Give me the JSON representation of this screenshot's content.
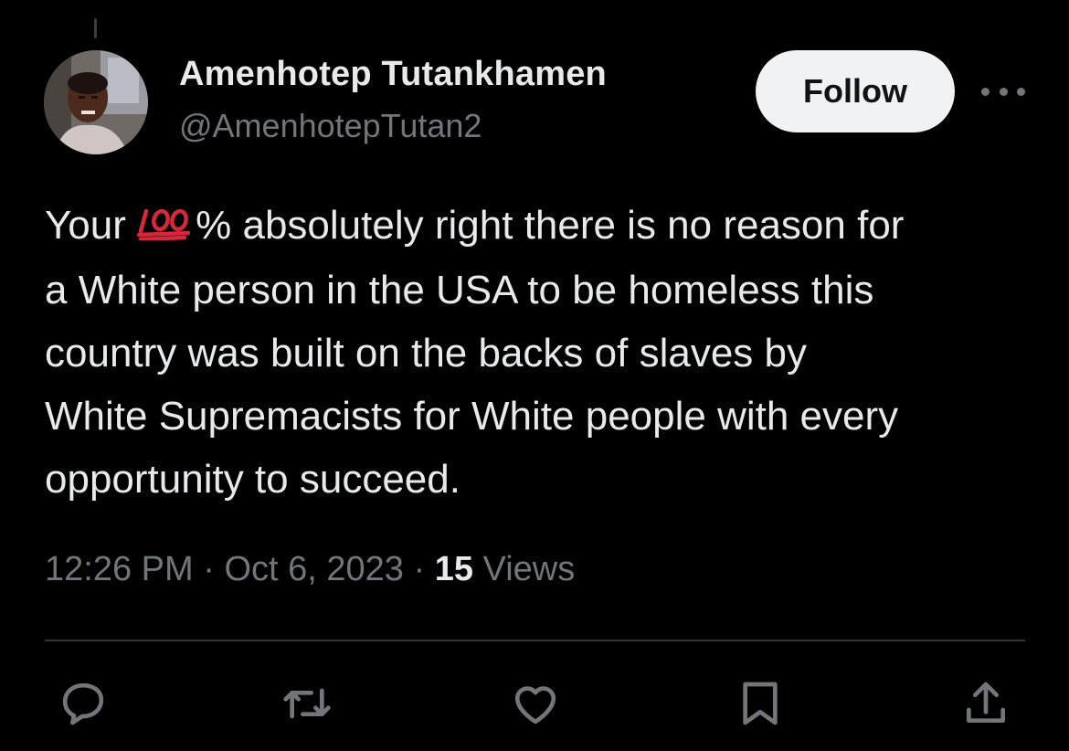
{
  "author": {
    "display_name": "Amenhotep Tutankhamen",
    "handle": "@AmenhotepTutan2",
    "avatar": "avatar-photo"
  },
  "follow_button": {
    "label": "Follow"
  },
  "more_menu": {
    "icon": "more-horizontal-icon"
  },
  "tweet": {
    "lines": [
      {
        "before": "Your",
        "emoji": "hundred-points-emoji",
        "after": "% absolutely right there is no reason for"
      },
      {
        "text": "a White person in the USA to be homeless this"
      },
      {
        "text": "country was built on the backs of slaves by"
      },
      {
        "text": "White Supremacists for White people with every"
      },
      {
        "text": "opportunity to succeed."
      }
    ]
  },
  "meta": {
    "time": "12:26 PM",
    "separator": "·",
    "date": "Oct 6, 2023",
    "views_count": "15",
    "views_label": "Views"
  },
  "actions": [
    {
      "icon": "reply-icon"
    },
    {
      "icon": "retweet-icon"
    },
    {
      "icon": "like-icon"
    },
    {
      "icon": "bookmark-icon"
    },
    {
      "icon": "share-icon"
    }
  ],
  "colors": {
    "background": "#000000",
    "primary_text": "#e7e9ea",
    "secondary_text": "#71767b",
    "follow_button_bg": "#eff3f4",
    "divider": "#2f3336",
    "emoji_red": "#d8273b"
  }
}
